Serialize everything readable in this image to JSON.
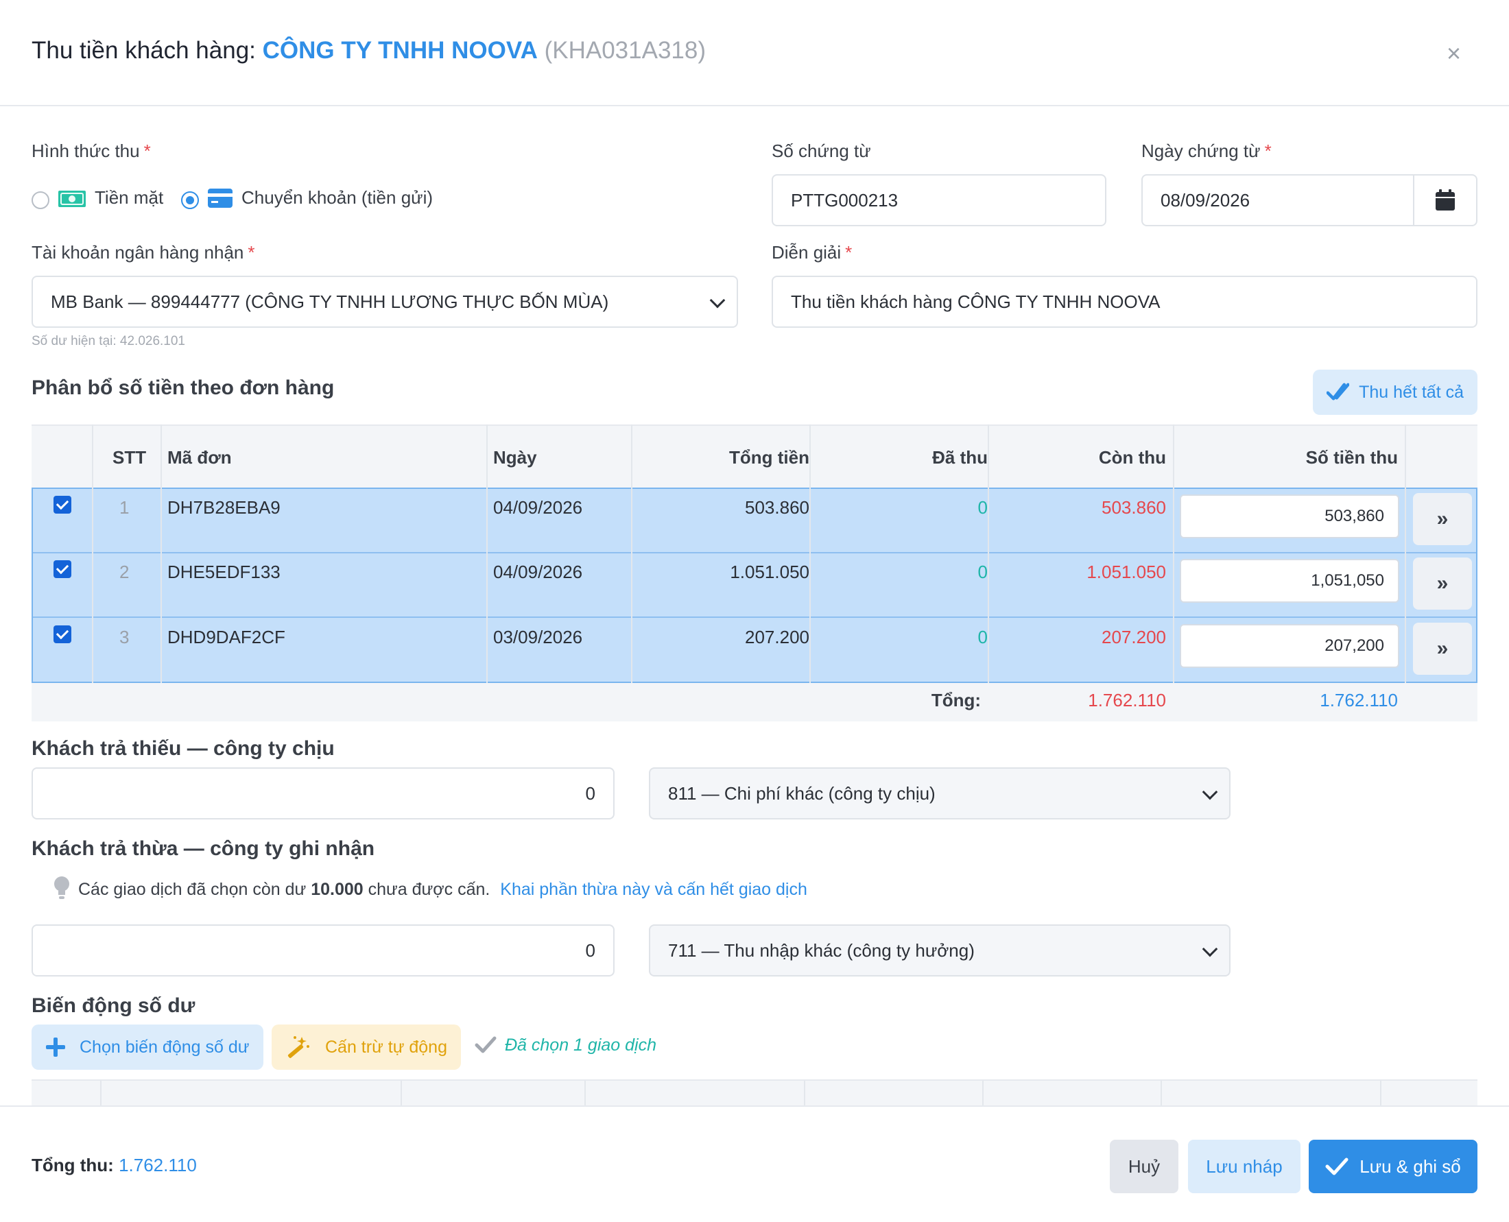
{
  "header": {
    "prefix": "Thu tiền khách hàng: ",
    "customer_name": "CÔNG TY TNHH NOOVA",
    "customer_code": "(KHA031A318)",
    "close": "×"
  },
  "form": {
    "payment_method_label": "Hình thức thu",
    "required_mark": "*",
    "method_cash": "Tiền mặt",
    "method_transfer": "Chuyển khoản (tiền gửi)",
    "selected_method": "Chuyển khoản (tiền gửi)",
    "voucher_no_label": "Số chứng từ",
    "voucher_no_value": "PTTG000213",
    "voucher_date_label": "Ngày chứng từ",
    "voucher_date_value": "08/09/2026",
    "bank_account_label": "Tài khoản ngân hàng nhận",
    "bank_account_value": "MB Bank — 899444777 (CÔNG TY TNHH LƯƠNG THỰC BỐN MÙA)",
    "balance_hint": "Số dư hiện tại: 42.026.101",
    "description_label": "Diễn giải",
    "description_value": "Thu tiền khách hàng CÔNG TY TNHH NOOVA"
  },
  "allocation": {
    "title": "Phân bổ số tiền theo đơn hàng",
    "collect_all_button": "Thu hết tất cả",
    "columns": [
      "STT",
      "Mã đơn",
      "Ngày",
      "Tổng tiền",
      "Đã thu",
      "Còn thu",
      "Số tiền thu"
    ],
    "rows": [
      {
        "stt": "1",
        "code": "DH7B28EBA9",
        "date": "04/09/2026",
        "total": "503.860",
        "paid": "0",
        "remaining": "503.860",
        "amount": "503,860",
        "go": "»"
      },
      {
        "stt": "2",
        "code": "DHE5EDF133",
        "date": "04/09/2026",
        "total": "1.051.050",
        "paid": "0",
        "remaining": "1.051.050",
        "amount": "1,051,050",
        "go": "»"
      },
      {
        "stt": "3",
        "code": "DHD9DAF2CF",
        "date": "03/09/2026",
        "total": "207.200",
        "paid": "0",
        "remaining": "207.200",
        "amount": "207,200",
        "go": "»"
      }
    ],
    "total_label": "Tổng:",
    "total_remaining": "1.762.110",
    "total_amount": "1.762.110"
  },
  "shortfall": {
    "title": "Khách trả thiếu — công ty chịu",
    "amount": "0",
    "account": "811 — Chi phí khác (công ty chịu)"
  },
  "overpay": {
    "title": "Khách trả thừa — công ty ghi nhận",
    "note_before": "Các giao dịch đã chọn còn dư ",
    "note_amount": "10.000",
    "note_after": " chưa được cấn.",
    "note_link": "Khai phần thừa này và cấn hết giao dịch",
    "amount": "0",
    "account": "711 — Thu nhập khác (công ty hưởng)"
  },
  "balance_changes": {
    "title": "Biến động số dư",
    "choose_button": "Chọn biến động số dư",
    "auto_button": "Cấn trừ tự động",
    "selected_note": "Đã chọn 1 giao dịch"
  },
  "footer": {
    "total_label": "Tổng thu:",
    "total_value": "1.762.110",
    "cancel": "Huỷ",
    "draft": "Lưu nháp",
    "save": "Lưu & ghi sổ"
  },
  "colors": {
    "accent": "#2f8ee6",
    "danger": "#e5484d",
    "success": "#1fb5a8",
    "selected_row": "#c4dffa"
  }
}
